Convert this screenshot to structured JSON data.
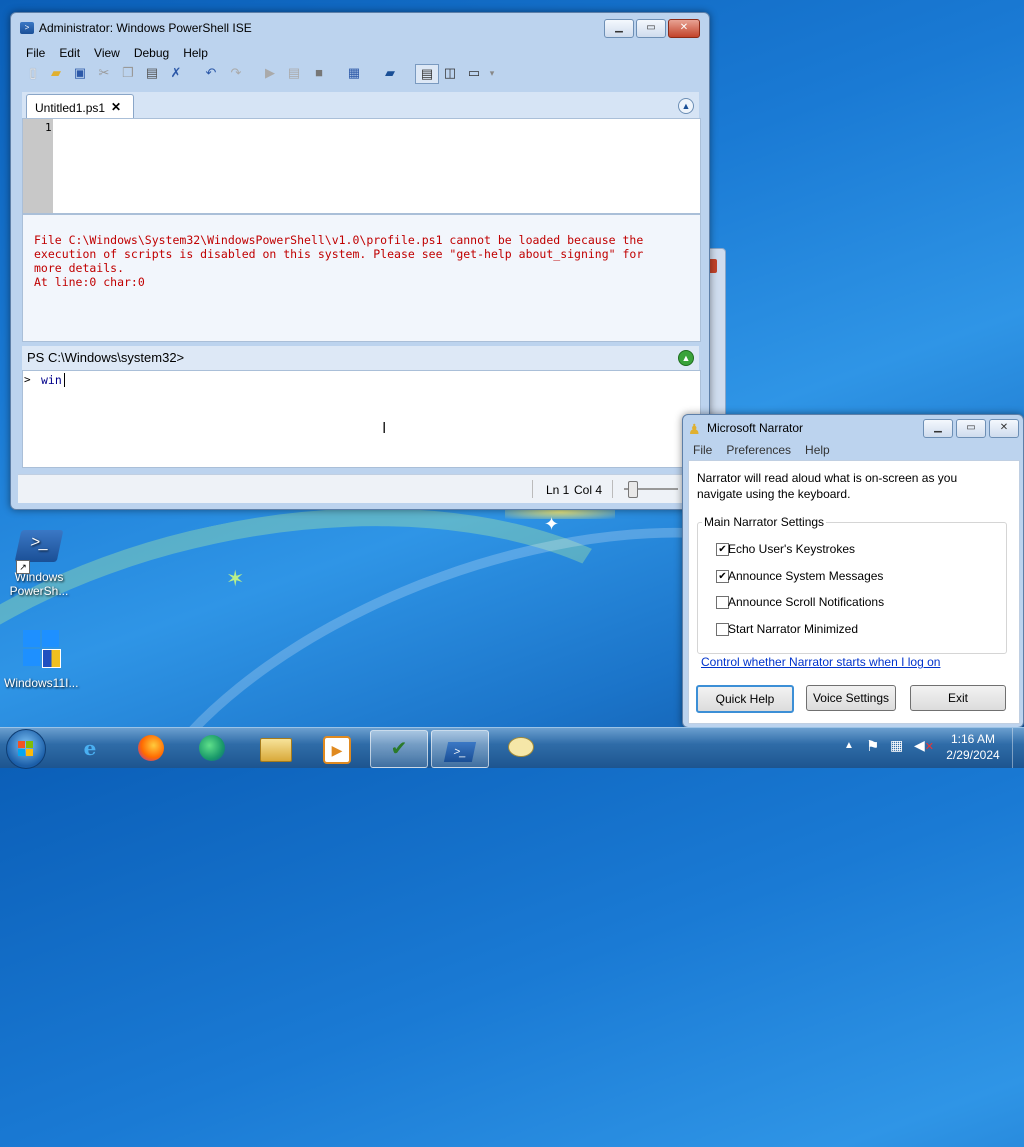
{
  "desktop": {
    "icons": [
      {
        "label_line1": "Windows",
        "label_line2": "PowerSh..."
      },
      {
        "label_line1": "Windows11I...",
        "label_line2": ""
      }
    ]
  },
  "ise": {
    "title": "Administrator: Windows PowerShell ISE",
    "menu": [
      "File",
      "Edit",
      "View",
      "Debug",
      "Help"
    ],
    "tab_label": "Untitled1.ps1",
    "tab_close": "✕",
    "line_number": "1",
    "error_lines": [
      "File C:\\Windows\\System32\\WindowsPowerShell\\v1.0\\profile.ps1 cannot be loaded because the",
      "execution of scripts is disabled on this system. Please see \"get-help about_signing\" for",
      "more details.",
      "At line:0 char:0"
    ],
    "prompt": "PS C:\\Windows\\system32>",
    "command_prefix": ">",
    "command_text": "win",
    "status_line": "Ln 1",
    "status_col": "Col 4"
  },
  "narrator": {
    "title": "Microsoft Narrator",
    "menu": [
      "File",
      "Preferences",
      "Help"
    ],
    "description_line1": "Narrator will read aloud what is on-screen as you",
    "description_line2": "navigate using the keyboard.",
    "group_title": "Main Narrator Settings",
    "options": [
      {
        "label": "Echo User's Keystrokes",
        "checked": "✔"
      },
      {
        "label": "Announce System Messages",
        "checked": "✔"
      },
      {
        "label": "Announce Scroll Notifications",
        "checked": ""
      },
      {
        "label": "Start Narrator Minimized",
        "checked": ""
      }
    ],
    "link": "Control whether Narrator starts when I log on",
    "buttons": {
      "quick_help": "Quick Help",
      "voice_settings": "Voice Settings",
      "exit": "Exit"
    }
  },
  "taskbar": {
    "time": "1:16 AM",
    "date": "2/29/2024"
  },
  "colors": {
    "error_red": "#c00000",
    "link_blue": "#0033cc",
    "command_blue": "#00008b"
  }
}
